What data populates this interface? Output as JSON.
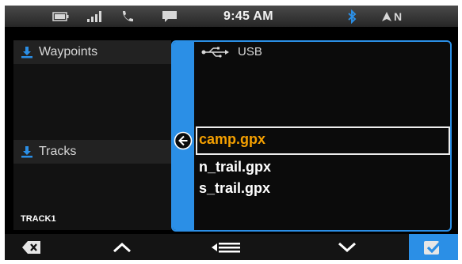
{
  "status_bar": {
    "time": "9:45 AM",
    "compass": "N",
    "icons": [
      "battery-icon",
      "signal-icon",
      "phone-icon",
      "message-icon",
      "bluetooth-icon",
      "compass-icon"
    ]
  },
  "left_panel": {
    "items": [
      {
        "label": "Waypoints",
        "icon": "download-icon"
      },
      {
        "label": "Tracks",
        "icon": "download-icon"
      }
    ],
    "footer_label": "TRACK1"
  },
  "right_panel": {
    "source_label": "USB",
    "source_icon": "usb-icon",
    "files": [
      "camp.gpx",
      "n_trail.gpx",
      "s_trail.gpx"
    ],
    "selected_index": 0
  },
  "bottom_bar": {
    "buttons": [
      "delete-button",
      "up-button",
      "menu-button",
      "down-button",
      "confirm-button"
    ]
  },
  "colors": {
    "accent": "#2b8fe6",
    "selected_text": "#f5a000"
  }
}
